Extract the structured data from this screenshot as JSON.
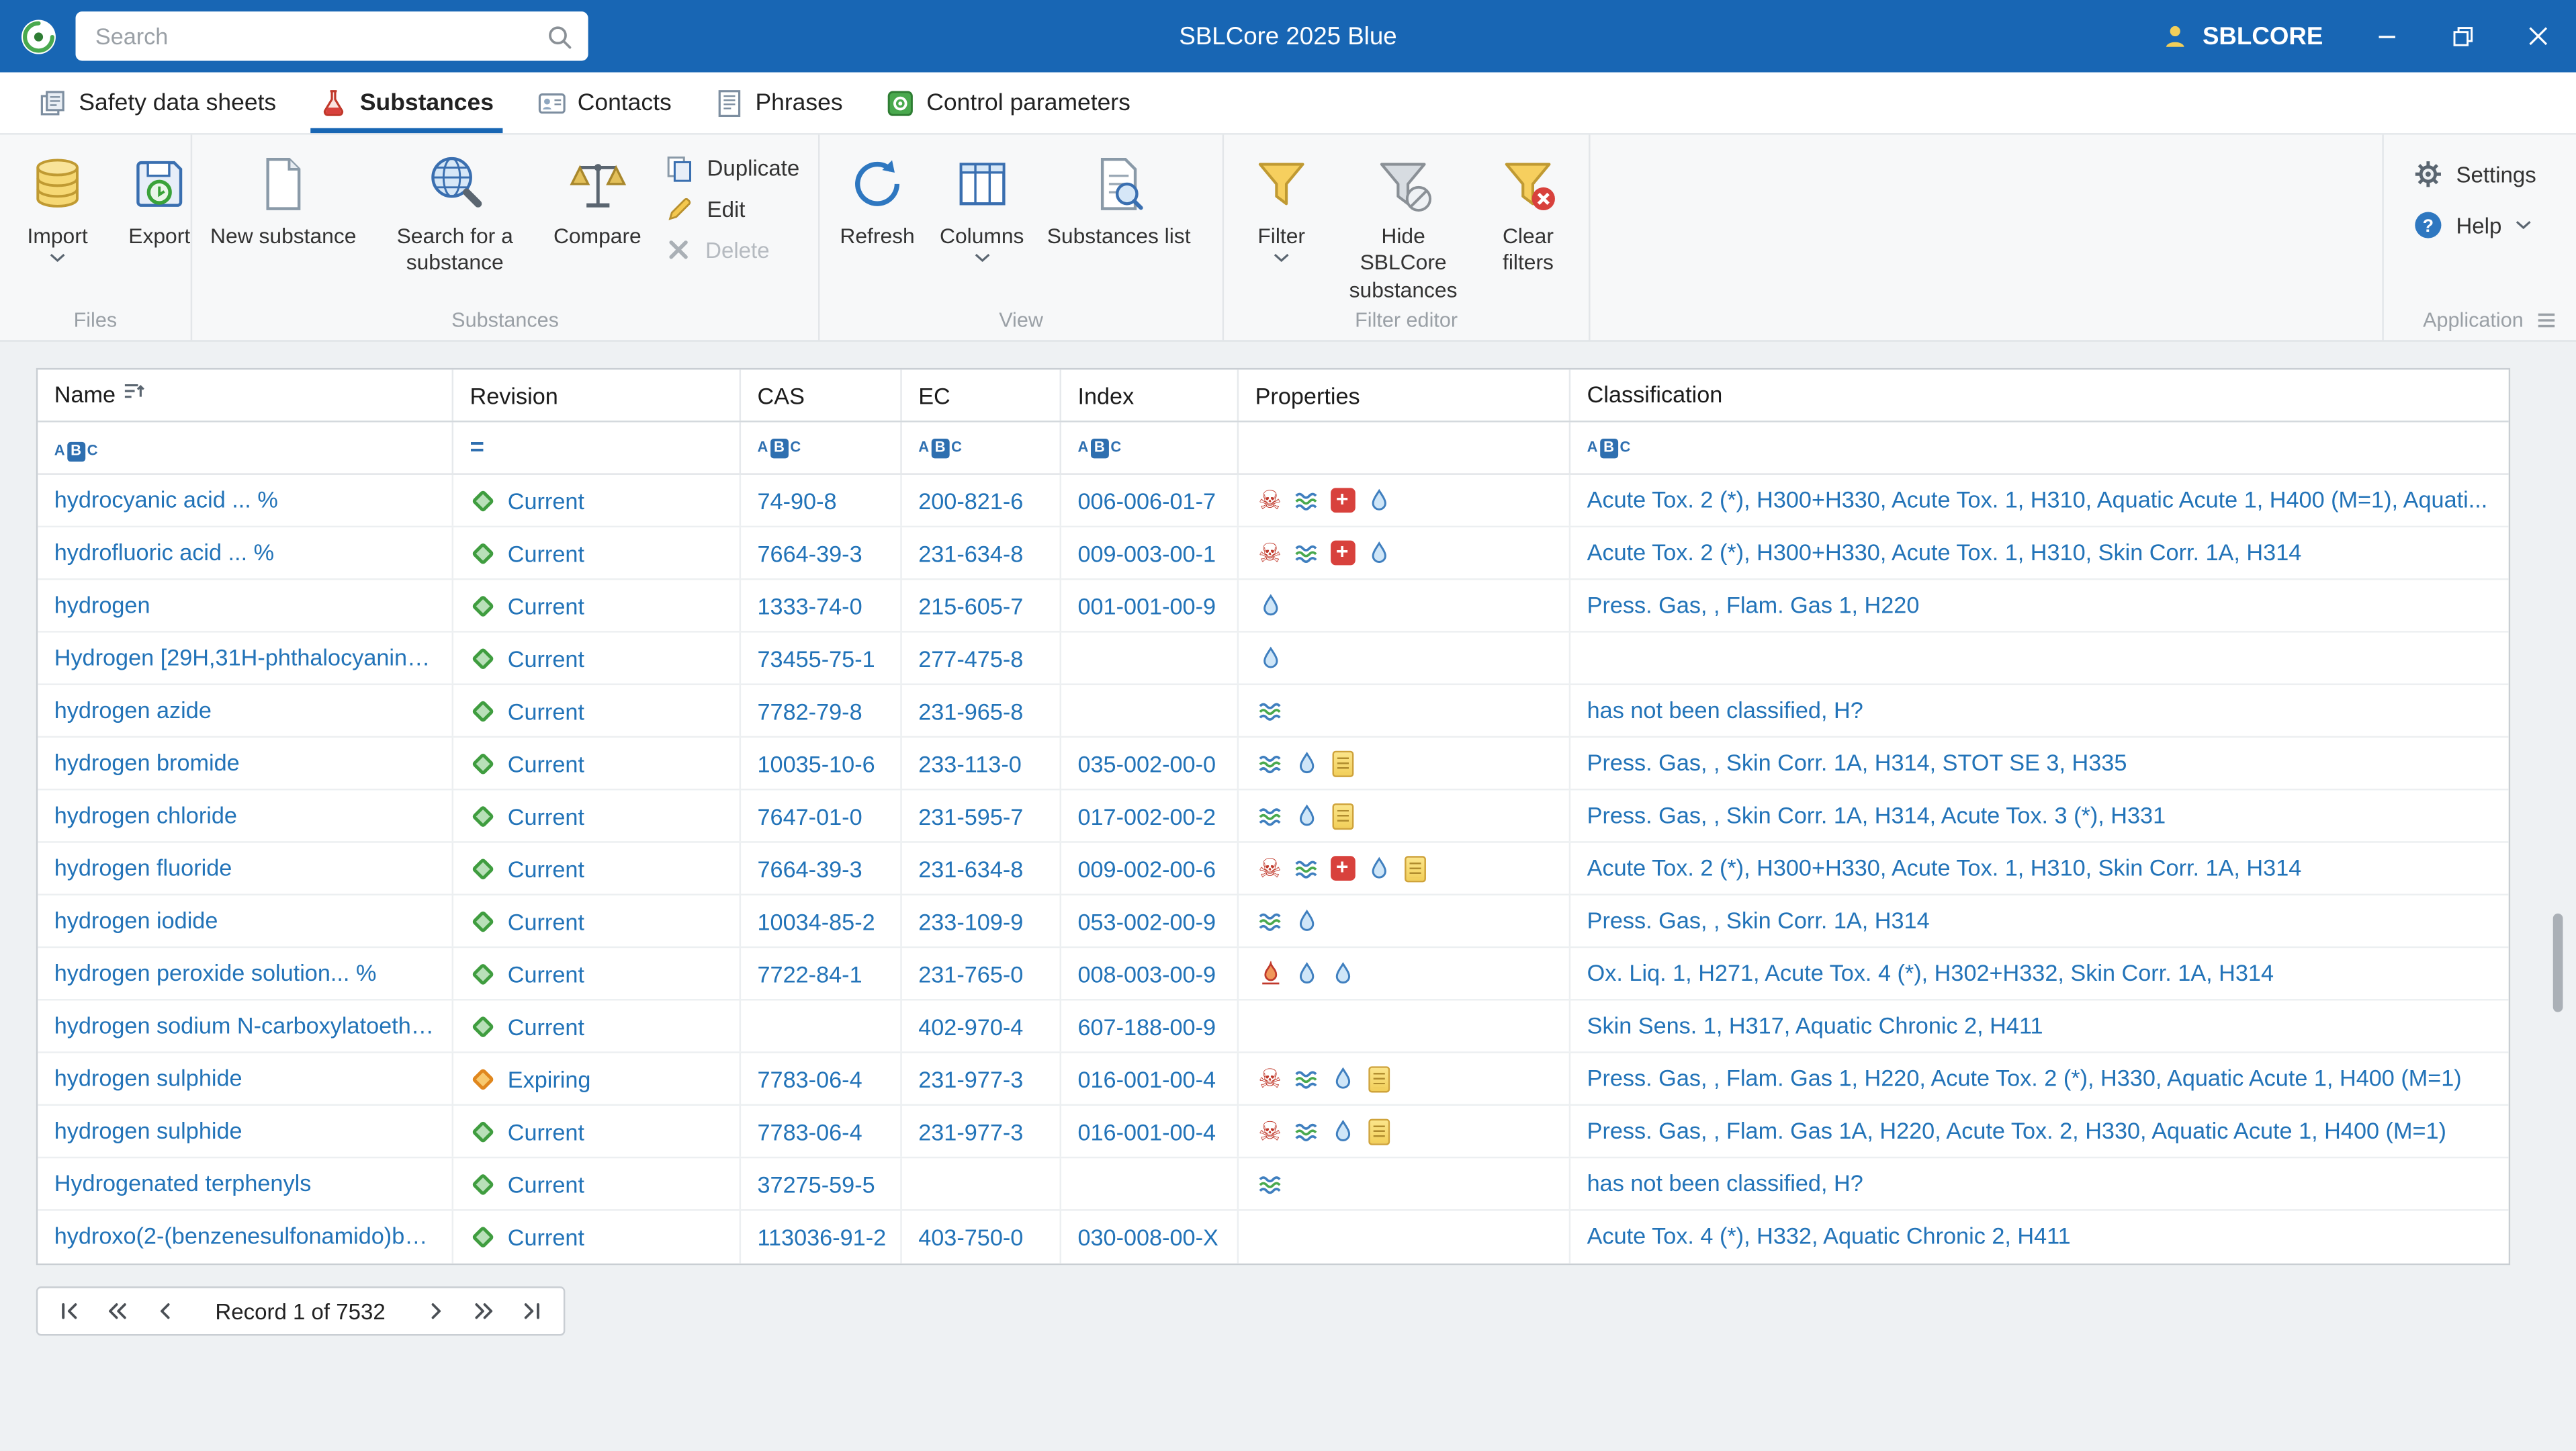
{
  "titlebar": {
    "search_placeholder": "Search",
    "title": "SBLCore 2025 Blue",
    "user": "SBLCORE"
  },
  "tabs": [
    {
      "label": "Safety data sheets"
    },
    {
      "label": "Substances"
    },
    {
      "label": "Contacts"
    },
    {
      "label": "Phrases"
    },
    {
      "label": "Control parameters"
    }
  ],
  "ribbon": {
    "files": {
      "label": "Files",
      "import": "Import",
      "export": "Export"
    },
    "substances": {
      "label": "Substances",
      "new_substance": "New substance",
      "search_for": "Search for a substance",
      "compare": "Compare",
      "duplicate": "Duplicate",
      "edit": "Edit",
      "delete": "Delete"
    },
    "view": {
      "label": "View",
      "refresh": "Refresh",
      "columns": "Columns",
      "substances_list": "Substances list"
    },
    "filter_editor": {
      "label": "Filter editor",
      "filter": "Filter",
      "hide": "Hide SBLCore substances",
      "clear": "Clear filters"
    },
    "application": {
      "label": "Application",
      "settings": "Settings",
      "help": "Help"
    }
  },
  "table": {
    "columns": [
      "Name",
      "Revision",
      "CAS",
      "EC",
      "Index",
      "Properties",
      "Classification"
    ],
    "filter_row": {
      "name": "abc",
      "revision": "=",
      "cas": "abc",
      "ec": "abc",
      "index": "abc",
      "properties": "",
      "classification": "abc"
    },
    "rows": [
      {
        "name": "hydrocyanic acid ... %",
        "revision": "Current",
        "cas": "74-90-8",
        "ec": "200-821-6",
        "index": "006-006-01-7",
        "properties": [
          "skull",
          "env",
          "firstaid",
          "droplet"
        ],
        "classification": "Acute Tox. 2 (*), H300+H330, Acute Tox. 1, H310, Aquatic Acute 1, H400 (M=1), Aquati..."
      },
      {
        "name": "hydrofluoric acid ... %",
        "revision": "Current",
        "cas": "7664-39-3",
        "ec": "231-634-8",
        "index": "009-003-00-1",
        "properties": [
          "skull",
          "env",
          "firstaid",
          "droplet"
        ],
        "classification": "Acute Tox. 2 (*), H300+H330, Acute Tox. 1, H310, Skin Corr. 1A, H314"
      },
      {
        "name": "hydrogen",
        "revision": "Current",
        "cas": "1333-74-0",
        "ec": "215-605-7",
        "index": "001-001-00-9",
        "properties": [
          "droplet"
        ],
        "classification": "Press. Gas, , Flam. Gas 1, H220"
      },
      {
        "name": "Hydrogen [29H,31H-phthalocyanine...",
        "revision": "Current",
        "cas": "73455-75-1",
        "ec": "277-475-8",
        "index": "",
        "properties": [
          "droplet"
        ],
        "classification": ""
      },
      {
        "name": "hydrogen azide",
        "revision": "Current",
        "cas": "7782-79-8",
        "ec": "231-965-8",
        "index": "",
        "properties": [
          "env"
        ],
        "classification": "has not been classified, H?"
      },
      {
        "name": "hydrogen bromide",
        "revision": "Current",
        "cas": "10035-10-6",
        "ec": "233-113-0",
        "index": "035-002-00-0",
        "properties": [
          "env",
          "droplet",
          "note"
        ],
        "classification": "Press. Gas, , Skin Corr. 1A, H314, STOT SE 3, H335"
      },
      {
        "name": "hydrogen chloride",
        "revision": "Current",
        "cas": "7647-01-0",
        "ec": "231-595-7",
        "index": "017-002-00-2",
        "properties": [
          "env",
          "droplet",
          "note"
        ],
        "classification": "Press. Gas, , Skin Corr. 1A, H314, Acute Tox. 3 (*), H331"
      },
      {
        "name": "hydrogen fluoride",
        "revision": "Current",
        "cas": "7664-39-3",
        "ec": "231-634-8",
        "index": "009-002-00-6",
        "properties": [
          "skull",
          "env",
          "firstaid",
          "droplet",
          "note"
        ],
        "classification": "Acute Tox. 2 (*), H300+H330, Acute Tox. 1, H310, Skin Corr. 1A, H314"
      },
      {
        "name": "hydrogen iodide",
        "revision": "Current",
        "cas": "10034-85-2",
        "ec": "233-109-9",
        "index": "053-002-00-9",
        "properties": [
          "env",
          "droplet"
        ],
        "classification": "Press. Gas, , Skin Corr. 1A, H314"
      },
      {
        "name": "hydrogen peroxide solution... %",
        "revision": "Current",
        "cas": "7722-84-1",
        "ec": "231-765-0",
        "index": "008-003-00-9",
        "properties": [
          "oxidizer",
          "droplet",
          "droplet"
        ],
        "classification": "Ox. Liq. 1, H271, Acute Tox. 4 (*), H302+H332, Skin Corr. 1A, H314"
      },
      {
        "name": "hydrogen sodium N-carboxylatoethy...",
        "revision": "Current",
        "cas": "",
        "ec": "402-970-4",
        "index": "607-188-00-9",
        "properties": [],
        "classification": "Skin Sens. 1, H317, Aquatic Chronic 2, H411"
      },
      {
        "name": "hydrogen sulphide",
        "revision": "Expiring",
        "cas": "7783-06-4",
        "ec": "231-977-3",
        "index": "016-001-00-4",
        "properties": [
          "skull",
          "env",
          "droplet",
          "note"
        ],
        "classification": "Press. Gas, , Flam. Gas 1, H220, Acute Tox. 2 (*), H330, Aquatic Acute 1, H400 (M=1)"
      },
      {
        "name": "hydrogen sulphide",
        "revision": "Current",
        "cas": "7783-06-4",
        "ec": "231-977-3",
        "index": "016-001-00-4",
        "properties": [
          "skull",
          "env",
          "droplet",
          "note"
        ],
        "classification": "Press. Gas, , Flam. Gas 1A, H220, Acute Tox. 2, H330, Aquatic Acute 1, H400 (M=1)"
      },
      {
        "name": "Hydrogenated terphenyls",
        "revision": "Current",
        "cas": "37275-59-5",
        "ec": "",
        "index": "",
        "properties": [
          "env"
        ],
        "classification": "has not been classified, H?"
      },
      {
        "name": "hydroxo(2-(benzenesulfonamido)be...",
        "revision": "Current",
        "cas": "113036-91-2",
        "ec": "403-750-0",
        "index": "030-008-00-X",
        "properties": [],
        "classification": "Acute Tox. 4 (*), H332, Aquatic Chronic 2, H411"
      }
    ]
  },
  "pager": {
    "record_label": "Record 1 of 7532"
  },
  "colors": {
    "accent": "#1866b4",
    "link": "#2273b8",
    "current_status": "#3f9d3f",
    "expiring_status": "#e0871e"
  }
}
